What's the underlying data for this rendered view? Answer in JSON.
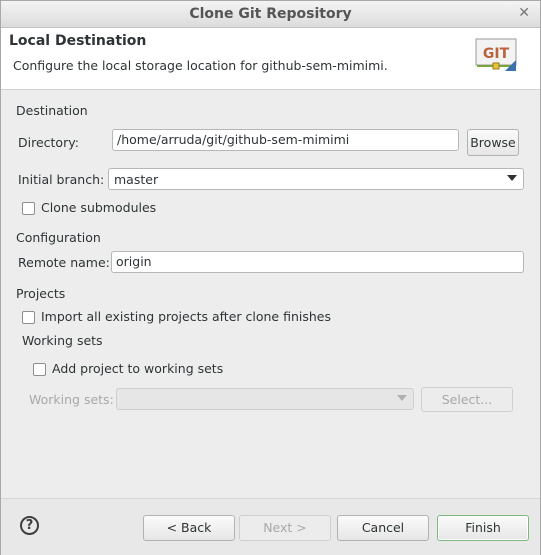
{
  "window": {
    "title": "Clone Git Repository"
  },
  "header": {
    "title": "Local Destination",
    "description": "Configure the local storage location for github-sem-mimimi.",
    "logo_text": "GIT"
  },
  "destination": {
    "section_label": "Destination",
    "directory_label": "Directory:",
    "directory_value": "/home/arruda/git/github-sem-mimimi",
    "browse_label": "Browse",
    "branch_label": "Initial branch:",
    "branch_value": "master",
    "clone_submodules_label": "Clone submodules",
    "clone_submodules_checked": false
  },
  "configuration": {
    "section_label": "Configuration",
    "remote_label": "Remote name:",
    "remote_value": "origin"
  },
  "projects": {
    "section_label": "Projects",
    "import_label": "Import all existing projects after clone finishes",
    "import_checked": false,
    "working_sets_label": "Working sets",
    "add_to_working_sets_label": "Add project to working sets",
    "add_to_working_sets_checked": false,
    "working_sets_field_label": "Working sets:",
    "select_label": "Select..."
  },
  "footer": {
    "help_glyph": "?",
    "back_label": "< Back",
    "next_label": "Next >",
    "cancel_label": "Cancel",
    "finish_label": "Finish"
  },
  "icons": {
    "help": "help-icon",
    "close": "close-icon",
    "git_logo": "git-logo-icon",
    "dropdown": "chevron-down-icon"
  }
}
